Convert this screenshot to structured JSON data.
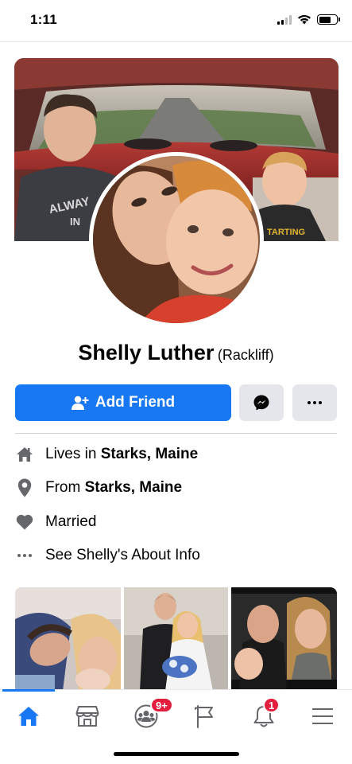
{
  "status_bar": {
    "time": "1:11",
    "battery_level": 0.7
  },
  "cover": {
    "shirt_text_1": "ALWAY",
    "shirt_text_2": "IN",
    "shirt_text_3": "TARTING"
  },
  "profile": {
    "name": "Shelly Luther",
    "alternate_name": "(Rackliff)"
  },
  "actions": {
    "add_friend_label": "Add Friend",
    "messenger_icon": "messenger-icon",
    "more_icon": "more-icon"
  },
  "info": {
    "lives_prefix": "Lives in ",
    "lives_place": "Starks, Maine",
    "from_prefix": "From ",
    "from_place": "Starks, Maine",
    "relationship": "Married",
    "see_about": "See Shelly's About Info"
  },
  "nav": {
    "active": "home",
    "groups_badge": "9+",
    "notifications_badge": "1"
  },
  "colors": {
    "accent": "#1877f2",
    "badge": "#e41e3f",
    "secondary_button": "#e4e6eb"
  }
}
